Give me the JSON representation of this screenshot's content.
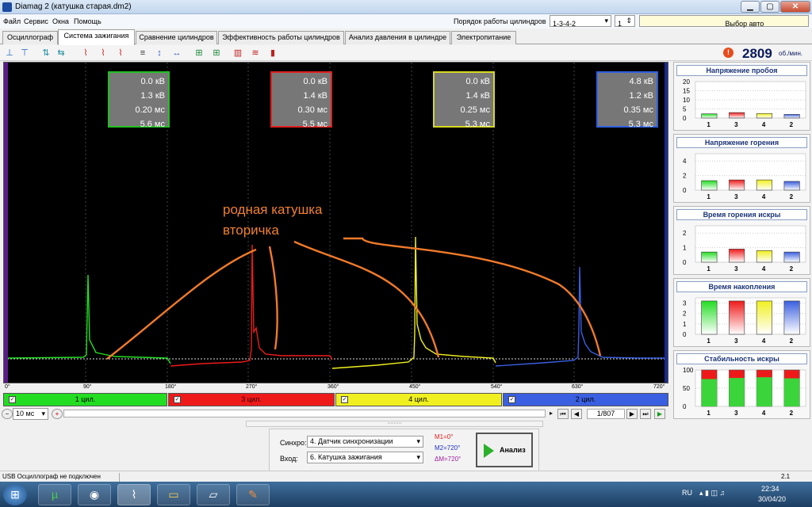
{
  "window": {
    "title": "Diamag 2 (катушка старая.dm2)"
  },
  "menu": [
    "Файл",
    "Сервис",
    "Окна",
    "Помощь"
  ],
  "cylinder_order": {
    "label": "Порядок работы цилиндров",
    "value": "1-3-4-2",
    "count": "1"
  },
  "car_select": "Выбор авто",
  "tabs": [
    "Осциллограф",
    "Система зажигания",
    "Сравнение цилиндров",
    "Эффективность работы цилиндров",
    "Анализ давления в цилиндре",
    "Электропитание"
  ],
  "active_tab": "Система зажигания",
  "rpm": {
    "value": "2809",
    "unit": "об./мин."
  },
  "info_boxes": [
    {
      "color": "#22c022",
      "lines": [
        "0.0 кВ",
        "1.3 кВ",
        "0.20 мс",
        "5.6 мс"
      ]
    },
    {
      "color": "#e02020",
      "lines": [
        "0.0 кВ",
        "1.4 кВ",
        "0.30 мс",
        "5.5 мс"
      ]
    },
    {
      "color": "#d8d820",
      "lines": [
        "0.0 кВ",
        "1.4 кВ",
        "0.25 мс",
        "5.3 мс"
      ]
    },
    {
      "color": "#3060e0",
      "lines": [
        "4.8 кВ",
        "1.2 кВ",
        "0.35 мс",
        "5.3 мс"
      ]
    }
  ],
  "annotation": [
    "родная катушка",
    "вторичка"
  ],
  "degree_ticks": [
    "0°",
    "90°",
    "180°",
    "270°",
    "360°",
    "450°",
    "540°",
    "630°",
    "720°"
  ],
  "cylinders": [
    {
      "label": "1 цил.",
      "color": "#22dd22"
    },
    {
      "label": "3 цил.",
      "color": "#ee1a1a"
    },
    {
      "label": "4 цил.",
      "color": "#f0f020"
    },
    {
      "label": "2 цил.",
      "color": "#3a5fe0"
    }
  ],
  "timebase": "10 мс",
  "frame": "1/807",
  "panels": [
    {
      "title": "Напряжение пробоя",
      "yticks": [
        "20",
        "15",
        "10",
        "5",
        "0"
      ],
      "ymax": 20,
      "values": [
        2.3,
        3.0,
        2.5,
        2.0
      ]
    },
    {
      "title": "Напряжение горения",
      "yticks": [
        "4",
        "2",
        "0"
      ],
      "ymax": 5,
      "values": [
        1.3,
        1.4,
        1.4,
        1.2
      ]
    },
    {
      "title": "Время горения искры",
      "yticks": [
        "2",
        "1",
        "0"
      ],
      "ymax": 2.5,
      "values": [
        0.7,
        0.9,
        0.8,
        0.7
      ]
    },
    {
      "title": "Время накопления",
      "yticks": [
        "3",
        "2",
        "1",
        "0"
      ],
      "ymax": 3.5,
      "values": [
        3.2,
        3.2,
        3.2,
        3.2
      ]
    },
    {
      "title": "Стабильность искры",
      "yticks": [
        "100",
        "50",
        "0"
      ],
      "ymax": 100,
      "values": [
        75,
        78,
        80,
        77
      ]
    }
  ],
  "panel_categories": [
    "1",
    "3",
    "4",
    "2"
  ],
  "sync": {
    "label": "Синхро:",
    "value": "4.  Датчик синхронизации"
  },
  "input": {
    "label": "Вход:",
    "value": "6.  Катушка зажигания"
  },
  "markers": [
    "M1=0°",
    "M2=720°",
    "ΔM=720°"
  ],
  "analyze_button": "Анализ",
  "status": {
    "left": "USB Осциллограф не подключен",
    "right": "2.1"
  },
  "tray": {
    "lang": "RU",
    "time": "22:34",
    "date": "30/04/20"
  }
}
